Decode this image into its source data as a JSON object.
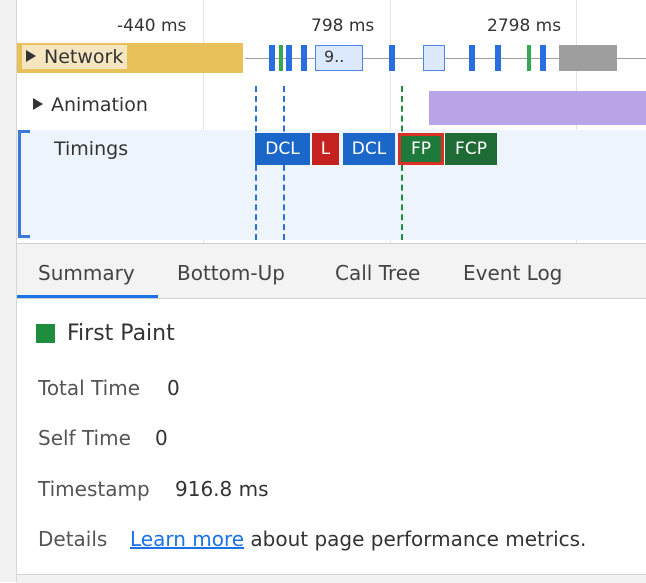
{
  "ruler": {
    "ticks": [
      "-440 ms",
      "798 ms",
      "2798 ms"
    ]
  },
  "tracks": {
    "network": {
      "label": "Network",
      "request_label": "9.."
    },
    "animation": {
      "label": "Animation"
    },
    "timings": {
      "label": "Timings",
      "markers": [
        {
          "label": "DCL",
          "color": "#1a67c9"
        },
        {
          "label": "L",
          "color": "#c5221f"
        },
        {
          "label": "DCL",
          "color": "#1a67c9"
        },
        {
          "label": "FP",
          "color": "#1e7a3a",
          "selected": true
        },
        {
          "label": "FCP",
          "color": "#1e6b35"
        }
      ]
    }
  },
  "tabs": [
    "Summary",
    "Bottom-Up",
    "Call Tree",
    "Event Log"
  ],
  "summary": {
    "event_title": "First Paint",
    "event_color": "#1e8e3e",
    "total_time_label": "Total Time",
    "total_time_value": "0",
    "self_time_label": "Self Time",
    "self_time_value": "0",
    "timestamp_label": "Timestamp",
    "timestamp_value": "916.8 ms",
    "details_label": "Details",
    "details_link": "Learn more",
    "details_text": "about page performance metrics."
  }
}
